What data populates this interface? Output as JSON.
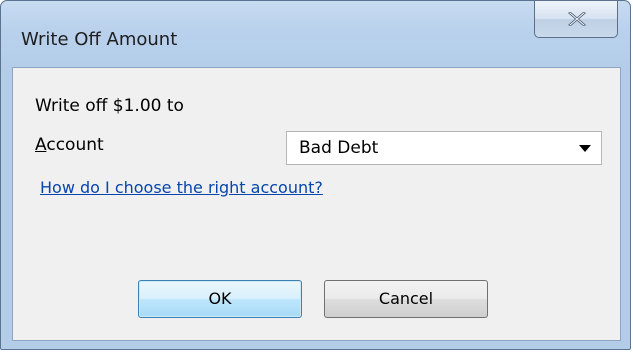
{
  "window": {
    "title": "Write Off Amount",
    "close_icon": "close-x-icon"
  },
  "form": {
    "write_off_text": "Write off $1.00 to",
    "account_label_accesskey": "A",
    "account_label_rest": "ccount",
    "account_value": "Bad Debt",
    "dropdown_icon": "chevron-down-icon",
    "help_link": "How do I choose the right account?"
  },
  "buttons": {
    "ok": "OK",
    "cancel": "Cancel"
  },
  "colors": {
    "link": "#0645ad",
    "title_bar": "#b9d1ec",
    "client_bg": "#f0f0f0"
  }
}
